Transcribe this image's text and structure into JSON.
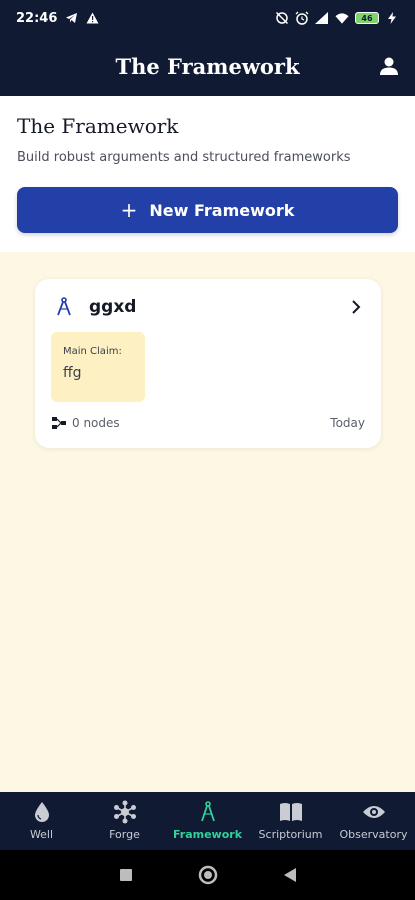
{
  "status_bar": {
    "time": "22:46",
    "battery": "46"
  },
  "app_bar": {
    "title": "The Framework",
    "user_icon": "user-icon"
  },
  "header": {
    "title": "The Framework",
    "subtitle": "Build robust arguments and structured frameworks",
    "new_button_label": "New Framework"
  },
  "card": {
    "title": "ggxd",
    "claim_label": "Main Claim:",
    "claim_value": "ffg",
    "nodes": "0 nodes",
    "date": "Today"
  },
  "nav": {
    "items": [
      {
        "label": "Well",
        "icon": "drop-icon"
      },
      {
        "label": "Forge",
        "icon": "forge-icon"
      },
      {
        "label": "Framework",
        "icon": "compass-icon",
        "active": true
      },
      {
        "label": "Scriptorium",
        "icon": "book-icon"
      },
      {
        "label": "Observatory",
        "icon": "eye-icon"
      }
    ]
  },
  "colors": {
    "primary": "#2340a8",
    "dark": "#101a33",
    "accent": "#2fd29a",
    "background": "#fdf8e4",
    "claim_bg": "#fdf0c2"
  }
}
